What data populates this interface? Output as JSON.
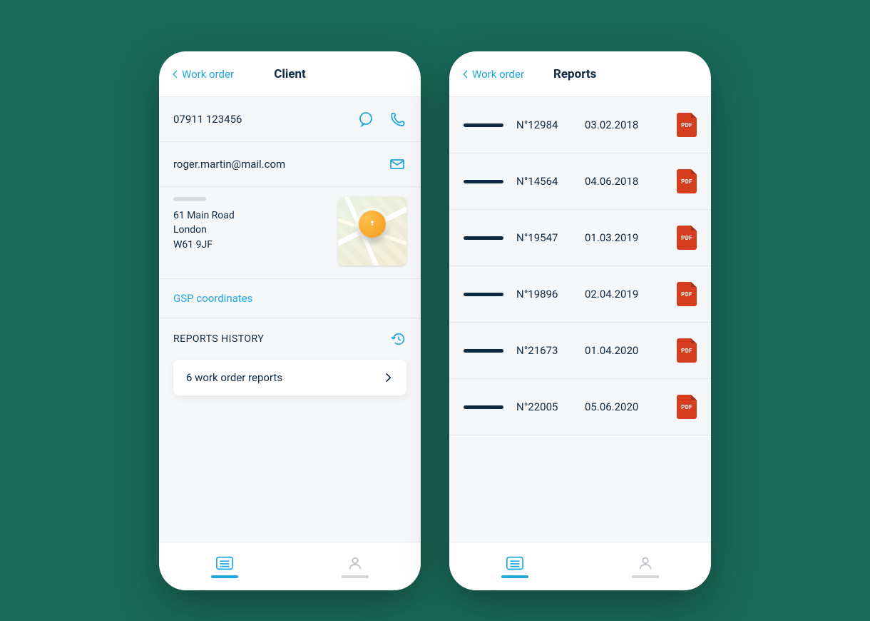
{
  "client_screen": {
    "back_label": "Work order",
    "title": "Client",
    "phone": "07911 123456",
    "email": "roger.martin@mail.com",
    "address_line1": "61 Main Road",
    "address_line2": "London",
    "address_line3": "W61 9JF",
    "gps_link": "GSP coordinates",
    "reports_header": "REPORTS HISTORY",
    "reports_summary": "6 work order reports"
  },
  "reports_screen": {
    "back_label": "Work order",
    "title": "Reports",
    "pdf_label": "PDF",
    "items": [
      {
        "number": "N°12984",
        "date": "03.02.2018"
      },
      {
        "number": "N°14564",
        "date": "04.06.2018"
      },
      {
        "number": "N°19547",
        "date": "01.03.2019"
      },
      {
        "number": "N°19896",
        "date": "02.04.2019"
      },
      {
        "number": "N°21673",
        "date": "01.04.2020"
      },
      {
        "number": "N°22005",
        "date": "05.06.2020"
      }
    ]
  }
}
